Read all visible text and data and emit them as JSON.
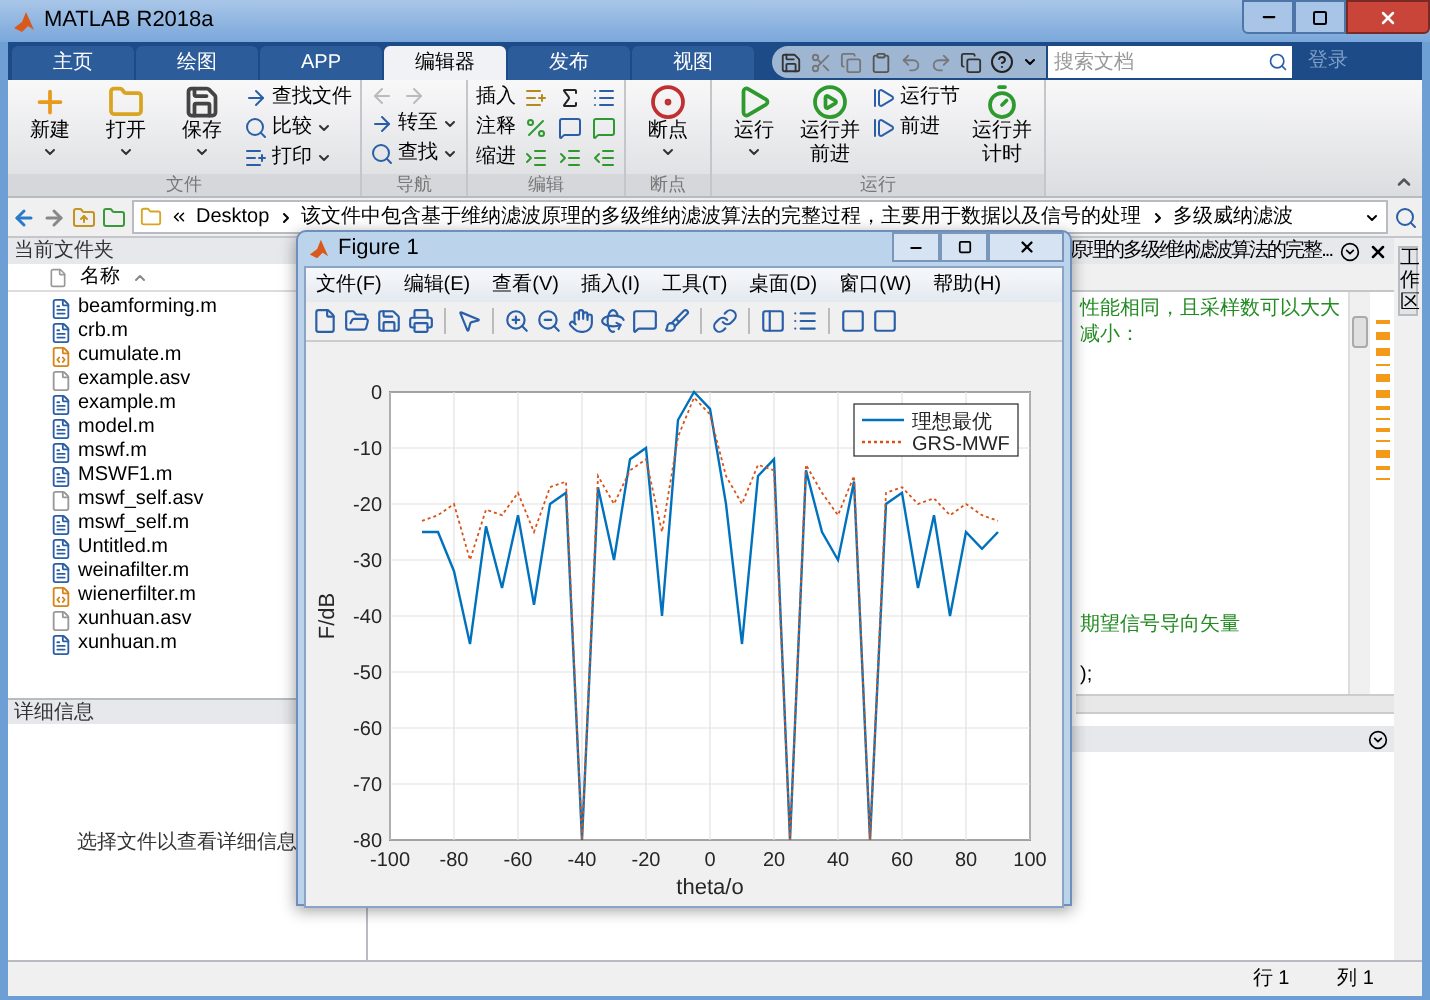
{
  "window": {
    "title": "MATLAB R2018a"
  },
  "tabs": [
    {
      "label": "主页",
      "selected": false
    },
    {
      "label": "绘图",
      "selected": false
    },
    {
      "label": "APP",
      "selected": false
    },
    {
      "label": "编辑器",
      "selected": true
    },
    {
      "label": "发布",
      "selected": false
    },
    {
      "label": "视图",
      "selected": false
    }
  ],
  "search": {
    "placeholder": "搜索文档"
  },
  "login": "登录",
  "ribbon": {
    "groups": [
      {
        "label": "文件",
        "items": [
          {
            "kind": "large",
            "label": "新建",
            "dropdown": true
          },
          {
            "kind": "large",
            "label": "打开",
            "dropdown": true
          },
          {
            "kind": "large",
            "label": "保存",
            "dropdown": true
          },
          {
            "kind": "small",
            "label": "查找文件",
            "dropdown": false
          },
          {
            "kind": "small",
            "label": "比较",
            "dropdown": true
          },
          {
            "kind": "small",
            "label": "打印",
            "dropdown": true
          }
        ]
      },
      {
        "label": "导航",
        "items": [
          {
            "kind": "small",
            "label": "转至",
            "dropdown": true
          },
          {
            "kind": "small",
            "label": "查找",
            "dropdown": true
          }
        ]
      },
      {
        "label": "编辑",
        "items": [
          {
            "kind": "small",
            "label": "插入",
            "dropdown": false
          },
          {
            "kind": "small",
            "label": "注释",
            "dropdown": false
          },
          {
            "kind": "small",
            "label": "缩进",
            "dropdown": false
          }
        ]
      },
      {
        "label": "断点",
        "items": [
          {
            "kind": "large",
            "label": "断点",
            "dropdown": true
          }
        ]
      },
      {
        "label": "运行",
        "items": [
          {
            "kind": "large",
            "label": "运行",
            "dropdown": true
          },
          {
            "kind": "large",
            "label": "运行并前进",
            "dropdown": false
          },
          {
            "kind": "small",
            "label": "运行节",
            "dropdown": false
          },
          {
            "kind": "small",
            "label": "前进",
            "dropdown": false
          },
          {
            "kind": "large",
            "label": "运行并计时",
            "dropdown": false
          }
        ]
      }
    ]
  },
  "address": {
    "segments": [
      "Desktop",
      "该文件中包含基于维纳滤波原理的多级维纳滤波算法的完整过程，主要用于数据以及信号的处理",
      "多级威纳滤波"
    ]
  },
  "current_folder": {
    "title": "当前文件夹",
    "column": "名称",
    "files": [
      {
        "name": "beamforming.m",
        "kind": "script"
      },
      {
        "name": "crb.m",
        "kind": "script"
      },
      {
        "name": "cumulate.m",
        "kind": "function"
      },
      {
        "name": "example.asv",
        "kind": "autosave"
      },
      {
        "name": "example.m",
        "kind": "script"
      },
      {
        "name": "model.m",
        "kind": "script"
      },
      {
        "name": "mswf.m",
        "kind": "script"
      },
      {
        "name": "MSWF1.m",
        "kind": "script"
      },
      {
        "name": "mswf_self.asv",
        "kind": "autosave"
      },
      {
        "name": "mswf_self.m",
        "kind": "script"
      },
      {
        "name": "Untitled.m",
        "kind": "script"
      },
      {
        "name": "weinafilter.m",
        "kind": "script"
      },
      {
        "name": "wienerfilter.m",
        "kind": "function"
      },
      {
        "name": "xunhuan.asv",
        "kind": "autosave"
      },
      {
        "name": "xunhuan.m",
        "kind": "script"
      }
    ]
  },
  "details": {
    "title": "详细信息",
    "message": "选择文件以查看详细信息"
  },
  "editor": {
    "tab_title": "原理的多级维纳滤波算法的完整...",
    "lines": [
      {
        "kind": "comment",
        "text": "性能相同，且采样数可以大大减小："
      },
      {
        "kind": "comment",
        "text": "期望信号导向矢量"
      },
      {
        "kind": "code",
        "text": ");"
      }
    ]
  },
  "workspace_tab": "工作区",
  "figure": {
    "title": "Figure 1",
    "menu": [
      "文件(F)",
      "编辑(E)",
      "查看(V)",
      "插入(I)",
      "工具(T)",
      "桌面(D)",
      "窗口(W)",
      "帮助(H)"
    ],
    "chart_data": {
      "type": "line",
      "xlabel": "theta/o",
      "ylabel": "F/dB",
      "x": [
        -90,
        -85,
        -80,
        -75,
        -70,
        -65,
        -60,
        -55,
        -50,
        -45,
        -40,
        -35,
        -30,
        -25,
        -20,
        -15,
        -10,
        -5,
        0,
        5,
        10,
        15,
        20,
        25,
        30,
        35,
        40,
        45,
        50,
        55,
        60,
        65,
        70,
        75,
        80,
        85,
        90
      ],
      "series": [
        {
          "name": "理想最优",
          "color": "#0072bd",
          "line_style": "solid",
          "values": [
            -25,
            -25,
            -32,
            -45,
            -24,
            -35,
            -22,
            -38,
            -20,
            -18,
            -80,
            -17,
            -30,
            -12,
            -10,
            -40,
            -5,
            0,
            -3,
            -20,
            -45,
            -15,
            -12,
            -80,
            -14,
            -25,
            -30,
            -16,
            -80,
            -20,
            -18,
            -35,
            -22,
            -40,
            -25,
            -28,
            -25
          ]
        },
        {
          "name": "GRS-MWF",
          "color": "#d95319",
          "line_style": "dotted",
          "values": [
            -23,
            -22,
            -20,
            -30,
            -21,
            -22,
            -18,
            -25,
            -17,
            -16,
            -80,
            -15,
            -20,
            -14,
            -12,
            -25,
            -8,
            -1,
            -4,
            -15,
            -20,
            -13,
            -14,
            -80,
            -13,
            -18,
            -22,
            -15,
            -80,
            -18,
            -17,
            -20,
            -19,
            -22,
            -20,
            -22,
            -23
          ]
        }
      ],
      "xlim": [
        -100,
        100
      ],
      "ylim": [
        -80,
        0
      ],
      "xticks": [
        -100,
        -80,
        -60,
        -40,
        -20,
        0,
        20,
        40,
        60,
        80,
        100
      ],
      "yticks": [
        -80,
        -70,
        -60,
        -50,
        -40,
        -30,
        -20,
        -10,
        0
      ],
      "grid": true,
      "legend": true
    }
  },
  "status_bar": {
    "row": "行 1",
    "col": "列 1"
  }
}
